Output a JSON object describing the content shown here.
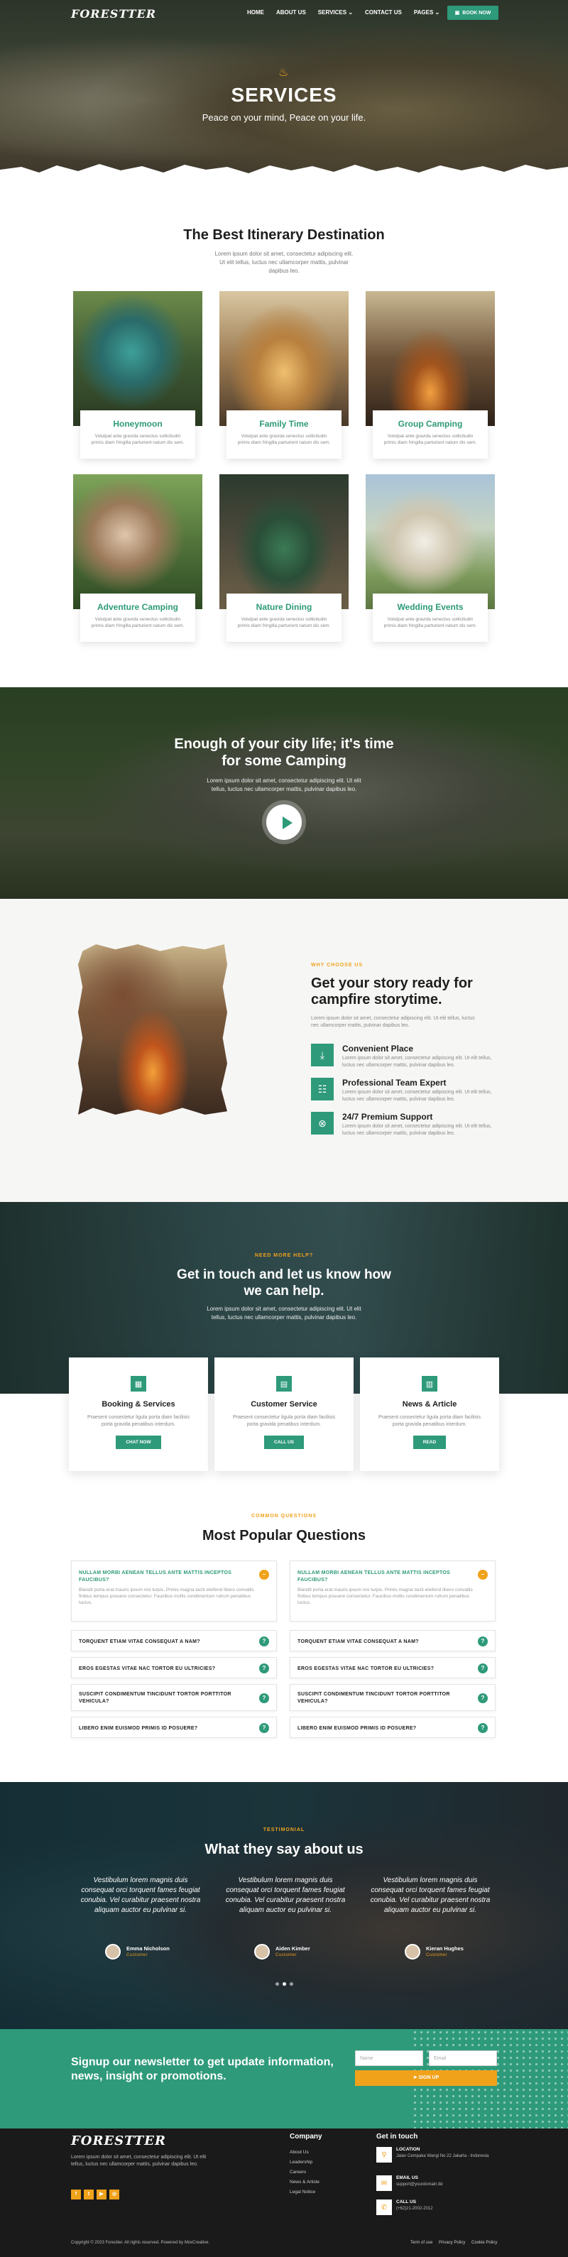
{
  "nav": {
    "logo": "FORESTTER",
    "menu": [
      "HOME",
      "ABOUT US",
      "SERVICES",
      "CONTACT US",
      "PAGES"
    ],
    "book_now": "BOOK NOW"
  },
  "hero": {
    "title": "SERVICES",
    "subtitle": "Peace on your mind, Peace on your life."
  },
  "itinerary": {
    "title": "The Best Itinerary Destination",
    "text": "Lorem ipsum dolor sit amet, consectetur adipiscing elit. Ut elit tellus, luctus nec ullamcorper mattis, pulvinar dapibus leo.",
    "cards": [
      {
        "title": "Honeymoon",
        "desc": "Volutpat ante gravida senectus sollicitudin primis diam fringilla parturient natum dis sem."
      },
      {
        "title": "Family Time",
        "desc": "Volutpat ante gravida senectus sollicitudin primis diam fringilla parturient natum dis sem."
      },
      {
        "title": "Group Camping",
        "desc": "Volutpat ante gravida senectus sollicitudin primis diam fringilla parturient natum dis sem."
      },
      {
        "title": "Adventure Camping",
        "desc": "Volutpat ante gravida senectus sollicitudin primis diam fringilla parturient natum dis sem."
      },
      {
        "title": "Nature Dining",
        "desc": "Volutpat ante gravida senectus sollicitudin primis diam fringilla parturient natum dis sem."
      },
      {
        "title": "Wedding Events",
        "desc": "Volutpat ante gravida senectus sollicitudin primis diam fringilla parturient natum dis sem."
      }
    ]
  },
  "video": {
    "title": "Enough of your city life; it's time for some Camping",
    "text": "Lorem ipsum dolor sit amet, consectetur adipiscing elit. Ut elit tellus, luctus nec ullamcorper mattis, pulvinar dapibus leo."
  },
  "why": {
    "eyebrow": "WHY CHOOSE US",
    "title": "Get your story ready for campfire storytime.",
    "text": "Lorem ipsum dolor sit amet, consectetur adipiscing elit. Ut elit tellus, luctus nec ullamcorper mattis, pulvinar dapibus leo.",
    "features": [
      {
        "title": "Convenient Place",
        "desc": "Lorem ipsum dolor sit amet, consectetur adipiscing elit. Ut elit tellus, luctus nec ullamcorper mattis, pulvinar dapibus leo."
      },
      {
        "title": "Professional Team Expert",
        "desc": "Lorem ipsum dolor sit amet, consectetur adipiscing elit. Ut elit tellus, luctus nec ullamcorper mattis, pulvinar dapibus leo."
      },
      {
        "title": "24/7 Premium Support",
        "desc": "Lorem ipsum dolor sit amet, consectetur adipiscing elit. Ut elit tellus, luctus nec ullamcorper mattis, pulvinar dapibus leo."
      }
    ]
  },
  "help": {
    "eyebrow": "NEED MORE HELP?",
    "title": "Get in touch and let us know how we can help.",
    "text": "Lorem ipsum dolor sit amet, consectetur adipiscing elit. Ut elit tellus, luctus nec ullamcorper mattis, pulvinar dapibus leo.",
    "cards": [
      {
        "title": "Booking & Services",
        "desc": "Praesent consectetur ligula porta diam facilisis porta gravida penatibus interdum.",
        "button": "CHAT NOW"
      },
      {
        "title": "Customer Service",
        "desc": "Praesent consectetur ligula porta diam facilisis porta gravida penatibus interdum.",
        "button": "CALL US"
      },
      {
        "title": "News & Article",
        "desc": "Praesent consectetur ligula porta diam facilisis porta gravida penatibus interdum.",
        "button": "READ"
      }
    ]
  },
  "faq": {
    "eyebrow": "COMMON QUESTIONS",
    "title": "Most Popular Questions",
    "open_answer": "Blandit porta erat mauris ipsum nisi turpis. Primis magna taciti eleifend libero convallis finibus tempus posuere consectetur. Faucibus mollis condimentum rutrum penatibus luctus.",
    "left": [
      "NULLAM MORBI AENEAN TELLUS ANTE MATTIS INCEPTOS FAUCIBUS?",
      "TORQUENT ETIAM VITAE CONSEQUAT A NAM?",
      "EROS EGESTAS VITAE NAC TORTOR EU ULTRICIES?",
      "SUSCIPIT CONDIMENTUM TINCIDUNT TORTOR PORTTITOR VEHICULA?",
      "LIBERO ENIM EUISMOD PRIMIS ID POSUERE?"
    ],
    "right": [
      "NULLAM MORBI AENEAN TELLUS ANTE MATTIS INCEPTOS FAUCIBUS?",
      "TORQUENT ETIAM VITAE CONSEQUAT A NAM?",
      "EROS EGESTAS VITAE NAC TORTOR EU ULTRICIES?",
      "SUSCIPIT CONDIMENTUM TINCIDUNT TORTOR PORTTITOR VEHICULA?",
      "LIBERO ENIM EUISMOD PRIMIS ID POSUERE?"
    ]
  },
  "testimonial": {
    "eyebrow": "TESTIMONIAL",
    "title": "What they say about us",
    "items": [
      {
        "quote": "Vestibulum lorem magnis duis consequat orci torquent fames feugiat conubia. Vel curabitur praesent nostra aliquam auctor eu pulvinar si.",
        "name": "Emma Nicholson",
        "role": "Customer"
      },
      {
        "quote": "Vestibulum lorem magnis duis consequat orci torquent fames feugiat conubia. Vel curabitur praesent nostra aliquam auctor eu pulvinar si.",
        "name": "Aiden Kimber",
        "role": "Customer"
      },
      {
        "quote": "Vestibulum lorem magnis duis consequat orci torquent fames feugiat conubia. Vel curabitur praesent nostra aliquam auctor eu pulvinar si.",
        "name": "Kieran Hughes",
        "role": "Customer"
      }
    ]
  },
  "newsletter": {
    "title": "Signup our newsletter to get update information, news, insight or promotions.",
    "name_placeholder": "Name",
    "email_placeholder": "Email",
    "button": "SIGN UP"
  },
  "footer": {
    "logo": "FORESTTER",
    "about": "Lorem ipsum dolor sit amet, consectetur adipiscing elit. Ut elit tellus, luctus nec ullamcorper mattis, pulvinar dapibus leo.",
    "company_head": "Company",
    "links": [
      "About Us",
      "Leadership",
      "Careers",
      "News & Article",
      "Legal Notice"
    ],
    "contact_head": "Get in touch",
    "location_label": "LOCATION",
    "location": "Jalan Cempaka Wangi No 22 Jakarta - Indonesia",
    "email_label": "EMAIL US",
    "email": "support@yourdomain.tld",
    "call_label": "CALL US",
    "phone": "(+62)21-2002-2012",
    "copyright": "Copyright © 2023 Forestter. All rights reserved. Powered by MoxCreative.",
    "legal": [
      "Term of use",
      "Privacy Policy",
      "Cookie Policy"
    ]
  },
  "colors": {
    "accent": "#2e9a7a",
    "highlight": "#f0a21b",
    "footer_bg": "#1a1a1a"
  }
}
